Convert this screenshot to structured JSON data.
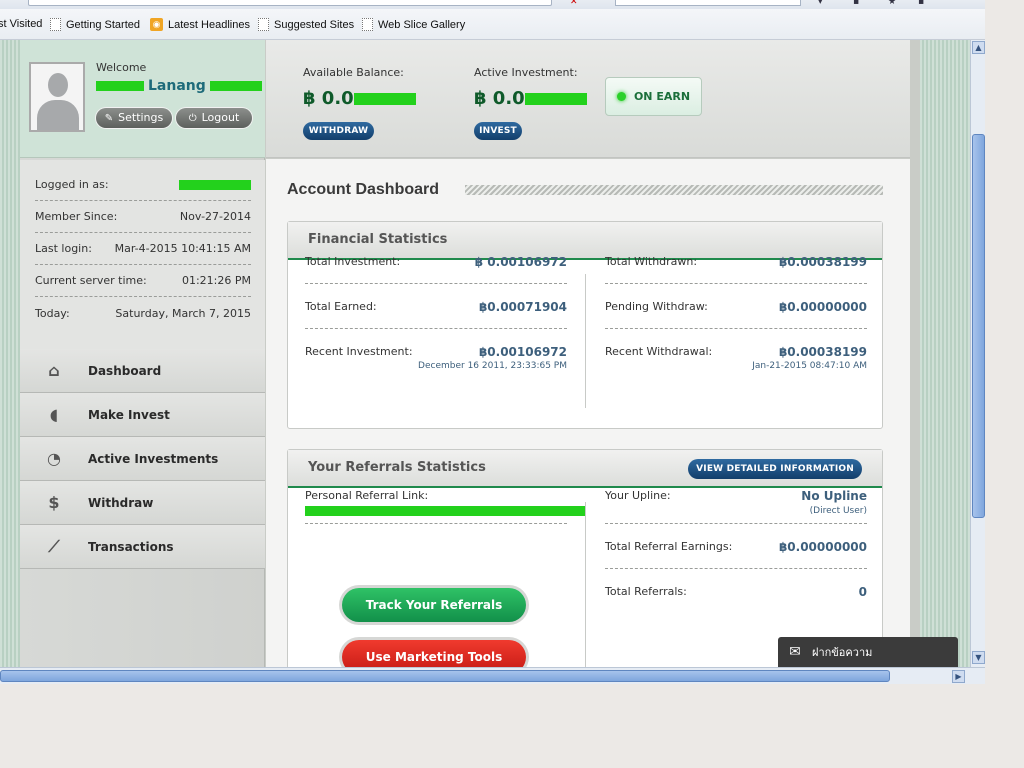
{
  "browser": {
    "favorites": [
      {
        "label": "st Visited",
        "icon": "page-icon"
      },
      {
        "label": "Getting Started",
        "icon": "page-icon"
      },
      {
        "label": "Latest Headlines",
        "icon": "rss-icon"
      },
      {
        "label": "Suggested Sites",
        "icon": "page-icon"
      },
      {
        "label": "Web Slice Gallery",
        "icon": "page-icon"
      }
    ]
  },
  "profile": {
    "welcome": "Welcome",
    "name_visible": "Lanang",
    "settings_label": "Settings",
    "logout_label": "Logout"
  },
  "account_info": [
    {
      "label": "Logged in as:",
      "value": ""
    },
    {
      "label": "Member Since:",
      "value": "Nov-27-2014"
    },
    {
      "label": "Last login:",
      "value": "Mar-4-2015 10:41:15 AM"
    },
    {
      "label": "Current server time:",
      "value": "01:21:26 PM"
    },
    {
      "label": "Today:",
      "value": "Saturday, March 7, 2015"
    }
  ],
  "menu": [
    {
      "label": "Dashboard",
      "icon": "home-icon"
    },
    {
      "label": "Make Invest",
      "icon": "piggy-bank-icon"
    },
    {
      "label": "Active Investments",
      "icon": "pie-chart-icon"
    },
    {
      "label": "Withdraw",
      "icon": "money-bag-icon"
    },
    {
      "label": "Transactions",
      "icon": "line-chart-icon"
    }
  ],
  "header": {
    "available_label": "Available Balance:",
    "available_value": "฿ 0.0",
    "withdraw_label": "WITHDRAW",
    "active_label": "Active Investment:",
    "active_value": "฿ 0.0",
    "invest_label": "INVEST",
    "status_label": "ON EARN"
  },
  "page": {
    "title": "Account Dashboard"
  },
  "financial": {
    "title": "Financial Statistics",
    "left": [
      {
        "label": "Total Investment:",
        "value": "฿ 0.00106972",
        "sub": ""
      },
      {
        "label": "Total Earned:",
        "value": "฿0.00071904",
        "sub": ""
      },
      {
        "label": "Recent Investment:",
        "value": "฿0.00106972",
        "sub": "December 16 2011, 23:33:65 PM"
      }
    ],
    "right": [
      {
        "label": "Total Withdrawn:",
        "value": "฿0.00038199",
        "sub": ""
      },
      {
        "label": "Pending Withdraw:",
        "value": "฿0.00000000",
        "sub": ""
      },
      {
        "label": "Recent Withdrawal:",
        "value": "฿0.00038199",
        "sub": "Jan-21-2015 08:47:10 AM"
      }
    ]
  },
  "referrals": {
    "title": "Your Referrals Statistics",
    "detail_button": "VIEW DETAILED INFORMATION",
    "link_label": "Personal Referral Link:",
    "track_button": "Track Your Referrals",
    "marketing_button": "Use Marketing Tools",
    "right": [
      {
        "label": "Your Upline:",
        "value": "No Upline",
        "sub": "(Direct User)"
      },
      {
        "label": "Total Referral Earnings:",
        "value": "฿0.00000000",
        "sub": ""
      },
      {
        "label": "Total Referrals:",
        "value": "0",
        "sub": ""
      }
    ]
  },
  "chat": {
    "label": "ฝากข้อความ"
  },
  "colors": {
    "accent_green": "#1f8a4c",
    "button_blue": "#123e6b",
    "track_green": "#1aa24f",
    "marketing_red": "#d8221b"
  }
}
